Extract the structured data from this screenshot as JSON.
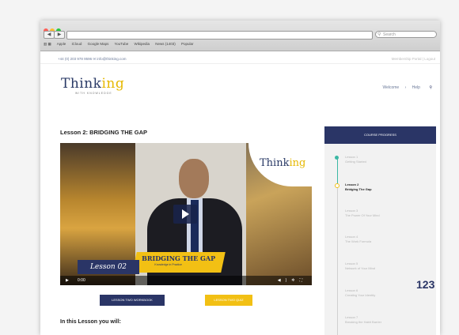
{
  "browser": {
    "back_label": "◀",
    "forward_label": "▶",
    "search_placeholder": "Search",
    "bookmarks": [
      "Apple",
      "iCloud",
      "Google Maps",
      "YouTube",
      "Wikipedia",
      "News (1403)",
      "Popular"
    ]
  },
  "site": {
    "topbar_left": "+44 (0) 203 978 9596   ✉ info@thinking.com",
    "topbar_right": "Membership Portal  |  Logout",
    "logo_pre": "Think",
    "logo_accent": "ing",
    "logo_sub": "WITH KNOWLEDGE",
    "nav": [
      "Welcome",
      "Help"
    ]
  },
  "lesson": {
    "title": "Lesson 2: BRIDGING THE GAP",
    "banner_lesson": "Lesson 02",
    "banner_title": "BRIDGING THE GAP",
    "banner_sub": "Knowledge in Practice",
    "time": "0:00",
    "workbook_button": "LESSON TWO WORKBOOK",
    "quiz_button": "LESSON TWO QUIZ",
    "learn_heading": "In this Lesson you will:"
  },
  "sidebar": {
    "header": "COURSE PROGRESS",
    "items": [
      {
        "label": "Lesson 1",
        "sub": "Getting Started"
      },
      {
        "label": "Lesson 2",
        "sub": "Bridging The Gap"
      },
      {
        "label": "Lesson 3",
        "sub": "The Power Of Your Mind"
      },
      {
        "label": "Lesson 4",
        "sub": "The Work Formula"
      },
      {
        "label": "Lesson 5",
        "sub": "Network of Your Mind"
      },
      {
        "label": "Lesson 6",
        "sub": "Creating Your Identity"
      },
      {
        "label": "Lesson 7",
        "sub": "Breaking the Habit Barrier"
      }
    ]
  },
  "page_number": "123",
  "colors": {
    "navy": "#2a3566",
    "yellow": "#f2c014",
    "teal": "#3cb8a4"
  }
}
